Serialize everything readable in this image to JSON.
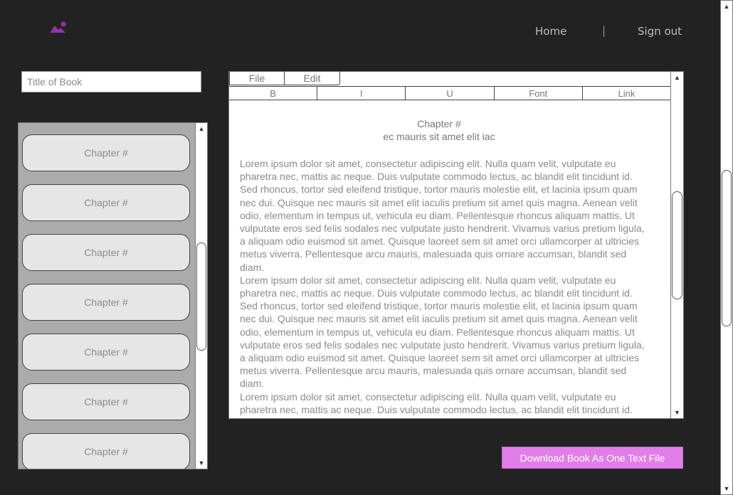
{
  "header": {
    "logo_icon": "image-icon",
    "brand_color": "#9b2fb0",
    "nav": {
      "home": "Home",
      "separator": "|",
      "sign_out": "Sign out"
    }
  },
  "sidebar": {
    "title_placeholder": "Title of Book",
    "title_value": "",
    "chapters": [
      {
        "label": "Chapter #"
      },
      {
        "label": "Chapter #"
      },
      {
        "label": "Chapter #"
      },
      {
        "label": "Chapter #"
      },
      {
        "label": "Chapter #"
      },
      {
        "label": "Chapter #"
      },
      {
        "label": "Chapter #"
      }
    ]
  },
  "editor": {
    "menu": {
      "file": "File",
      "edit": "Edit"
    },
    "format_buttons": [
      "B",
      "I",
      "U",
      "Font",
      "Link"
    ],
    "chapter_title": "Chapter #",
    "chapter_subtitle": "ec mauris sit amet elit iac",
    "paragraphs": [
      "Lorem ipsum dolor sit amet, consectetur adipiscing elit. Nulla quam velit, vulputate eu pharetra nec, mattis ac neque. Duis vulputate commodo lectus, ac blandit elit tincidunt id. Sed rhoncus, tortor sed eleifend tristique, tortor mauris molestie elit, et lacinia ipsum quam nec dui. Quisque nec mauris sit amet elit iaculis pretium sit amet quis magna. Aenean velit odio, elementum in tempus ut, vehicula eu diam. Pellentesque rhoncus aliquam mattis. Ut vulputate eros sed felis sodales nec vulputate justo hendrerit. Vivamus varius pretium ligula, a aliquam odio euismod sit amet. Quisque laoreet sem sit amet orci ullamcorper at ultricies metus viverra. Pellentesque arcu mauris, malesuada quis ornare accumsan, blandit sed diam.",
      "Lorem ipsum dolor sit amet, consectetur adipiscing elit. Nulla quam velit, vulputate eu pharetra nec, mattis ac neque. Duis vulputate commodo lectus, ac blandit elit tincidunt id. Sed rhoncus, tortor sed eleifend tristique, tortor mauris molestie elit, et lacinia ipsum quam nec dui. Quisque nec mauris sit amet elit iaculis pretium sit amet quis magna. Aenean velit odio, elementum in tempus ut, vehicula eu diam. Pellentesque rhoncus aliquam mattis. Ut vulputate eros sed felis sodales nec vulputate justo hendrerit. Vivamus varius pretium ligula, a aliquam odio euismod sit amet. Quisque laoreet sem sit amet orci ullamcorper at ultricies metus viverra. Pellentesque arcu mauris, malesuada quis ornare accumsan, blandit sed diam.",
      "Lorem ipsum dolor sit amet, consectetur adipiscing elit. Nulla quam velit, vulputate eu pharetra nec, mattis ac neque. Duis vulputate commodo lectus, ac blandit elit tincidunt id. Sed rhoncus, tortor sed eleifend tristique, tortor mauris molestie elit, et lacinia ipsum quam nec dui. Quisque nec mauris sit amet elit iaculis pretium sit amet quis magna."
    ]
  },
  "download": {
    "label": "Download Book As One Text File",
    "color": "#e27ee8"
  },
  "scrollbar_icons": {
    "up": "arrow-up-icon",
    "down": "arrow-down-icon"
  }
}
